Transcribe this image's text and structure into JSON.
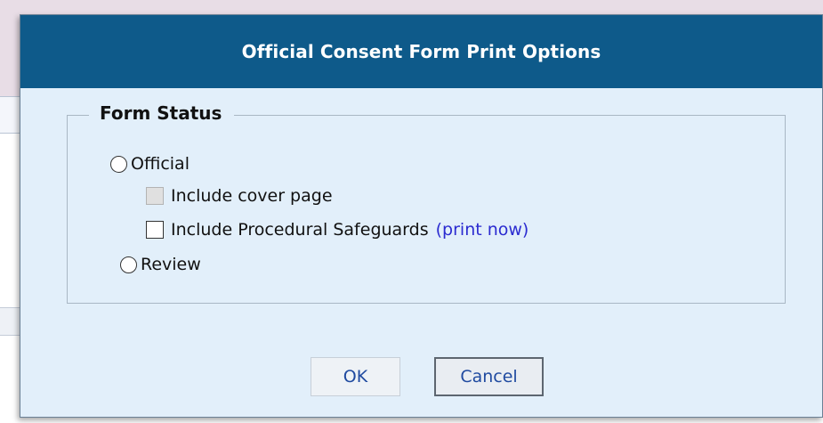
{
  "dialog": {
    "title": "Official Consent Form Print Options",
    "fieldset_legend": "Form Status",
    "options": {
      "official_label": "Official",
      "cover_page_label": "Include cover page",
      "safeguards_label": "Include Procedural Safeguards",
      "print_now_link": "(print now)",
      "review_label": "Review"
    },
    "buttons": {
      "ok_label": "OK",
      "cancel_label": "Cancel"
    }
  },
  "colors": {
    "titlebar": "#0e5a8a",
    "dialog_body": "#e2effa",
    "link": "#2b2bd0",
    "button_text": "#1f4aa0"
  }
}
